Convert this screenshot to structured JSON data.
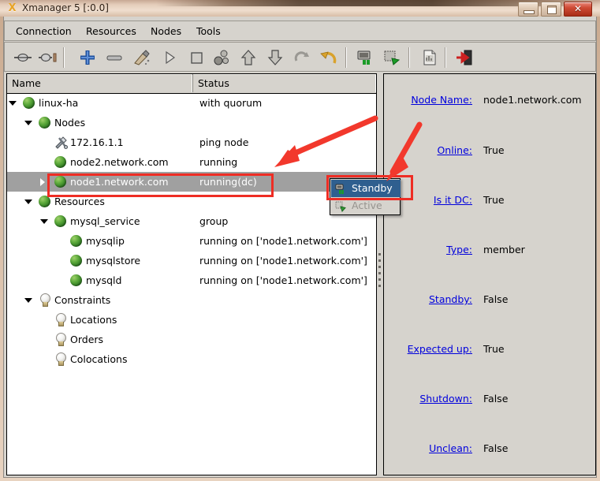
{
  "window": {
    "title": "Xmanager 5 [:0.0]",
    "app_icon": "x-logo-icon",
    "minimize_label": "",
    "maximize_label": "",
    "close_label": "✕"
  },
  "menubar": {
    "items": [
      {
        "label": "Connection",
        "name": "menu-connection"
      },
      {
        "label": "Resources",
        "name": "menu-resources"
      },
      {
        "label": "Nodes",
        "name": "menu-nodes"
      },
      {
        "label": "Tools",
        "name": "menu-tools"
      }
    ]
  },
  "toolbar": {
    "buttons": [
      {
        "name": "connect-icon",
        "tooltip": "Connect"
      },
      {
        "name": "disconnect-icon",
        "tooltip": "Disconnect"
      },
      {
        "name": "add-icon",
        "tooltip": "Add"
      },
      {
        "name": "remove-icon",
        "tooltip": "Remove"
      },
      {
        "name": "cleanup-brush-icon",
        "tooltip": "Cleanup"
      },
      {
        "name": "start-icon",
        "tooltip": "Start"
      },
      {
        "name": "stop-icon",
        "tooltip": "Stop"
      },
      {
        "name": "migrate-icon",
        "tooltip": "Migrate"
      },
      {
        "name": "move-up-icon",
        "tooltip": "Move Up"
      },
      {
        "name": "move-down-icon",
        "tooltip": "Move Down"
      },
      {
        "name": "refresh-icon",
        "tooltip": "Refresh"
      },
      {
        "name": "undo-icon",
        "tooltip": "Undo"
      },
      {
        "name": "node-standby-icon",
        "tooltip": "Standby"
      },
      {
        "name": "node-active-icon",
        "tooltip": "Active"
      },
      {
        "name": "report-icon",
        "tooltip": "Report"
      },
      {
        "name": "exit-icon",
        "tooltip": "Exit"
      }
    ]
  },
  "tree": {
    "columns": [
      {
        "label": "Name",
        "name": "column-name"
      },
      {
        "label": "Status",
        "name": "column-status"
      }
    ],
    "rows": [
      {
        "name": "linux-ha",
        "status": "with quorum",
        "indent": 0,
        "icon": "green-ball-icon",
        "twisty": "open",
        "selected": false
      },
      {
        "name": "Nodes",
        "status": "",
        "indent": 1,
        "icon": "green-ball-icon",
        "twisty": "open",
        "selected": false
      },
      {
        "name": "172.16.1.1",
        "status": "ping node",
        "indent": 2,
        "icon": "tools-icon",
        "twisty": "none",
        "selected": false
      },
      {
        "name": "node2.network.com",
        "status": "running",
        "indent": 2,
        "icon": "green-ball-icon",
        "twisty": "none",
        "selected": false
      },
      {
        "name": "node1.network.com",
        "status": "running(dc)",
        "indent": 2,
        "icon": "green-ball-icon",
        "twisty": "closed",
        "selected": true
      },
      {
        "name": "Resources",
        "status": "",
        "indent": 1,
        "icon": "green-ball-icon",
        "twisty": "open",
        "selected": false
      },
      {
        "name": "mysql_service",
        "status": "group",
        "indent": 2,
        "icon": "green-ball-icon",
        "twisty": "open",
        "selected": false
      },
      {
        "name": "mysqlip",
        "status": "running on ['node1.network.com']",
        "indent": 3,
        "icon": "green-ball-icon",
        "twisty": "none",
        "selected": false
      },
      {
        "name": "mysqlstore",
        "status": "running on ['node1.network.com']",
        "indent": 3,
        "icon": "green-ball-icon",
        "twisty": "none",
        "selected": false
      },
      {
        "name": "mysqld",
        "status": "running on ['node1.network.com']",
        "indent": 3,
        "icon": "green-ball-icon",
        "twisty": "none",
        "selected": false
      },
      {
        "name": "Constraints",
        "status": "",
        "indent": 1,
        "icon": "bulb-icon",
        "twisty": "open",
        "selected": false
      },
      {
        "name": "Locations",
        "status": "",
        "indent": 2,
        "icon": "bulb-icon",
        "twisty": "none",
        "selected": false
      },
      {
        "name": "Orders",
        "status": "",
        "indent": 2,
        "icon": "bulb-icon",
        "twisty": "none",
        "selected": false
      },
      {
        "name": "Colocations",
        "status": "",
        "indent": 2,
        "icon": "bulb-icon",
        "twisty": "none",
        "selected": false
      }
    ]
  },
  "details": {
    "fields": [
      {
        "label": "Node Name:",
        "value": "node1.network.com",
        "name": "field-node-name"
      },
      {
        "label": "Online:",
        "value": "True",
        "name": "field-online"
      },
      {
        "label": "Is it DC:",
        "value": "True",
        "name": "field-is-it-dc"
      },
      {
        "label": "Type:",
        "value": "member",
        "name": "field-type"
      },
      {
        "label": "Standby:",
        "value": "False",
        "name": "field-standby"
      },
      {
        "label": "Expected up:",
        "value": "True",
        "name": "field-expected-up"
      },
      {
        "label": "Shutdown:",
        "value": "False",
        "name": "field-shutdown"
      },
      {
        "label": "Unclean:",
        "value": "False",
        "name": "field-unclean"
      }
    ]
  },
  "context_menu": {
    "items": [
      {
        "label": "Standby",
        "name": "context-menu-item-standby",
        "state": "highlighted",
        "icon": "node-standby-icon"
      },
      {
        "label": "Active",
        "name": "context-menu-item-active",
        "state": "disabled",
        "icon": "node-active-icon"
      }
    ]
  },
  "annotations": {
    "color": "#ee2d24",
    "shapes": [
      {
        "type": "rect",
        "name": "annotation-rect-selected-row"
      },
      {
        "type": "rect",
        "name": "annotation-rect-standby-item"
      },
      {
        "type": "arrow",
        "name": "annotation-arrow-to-row"
      },
      {
        "type": "arrow",
        "name": "annotation-arrow-to-standby"
      }
    ]
  }
}
